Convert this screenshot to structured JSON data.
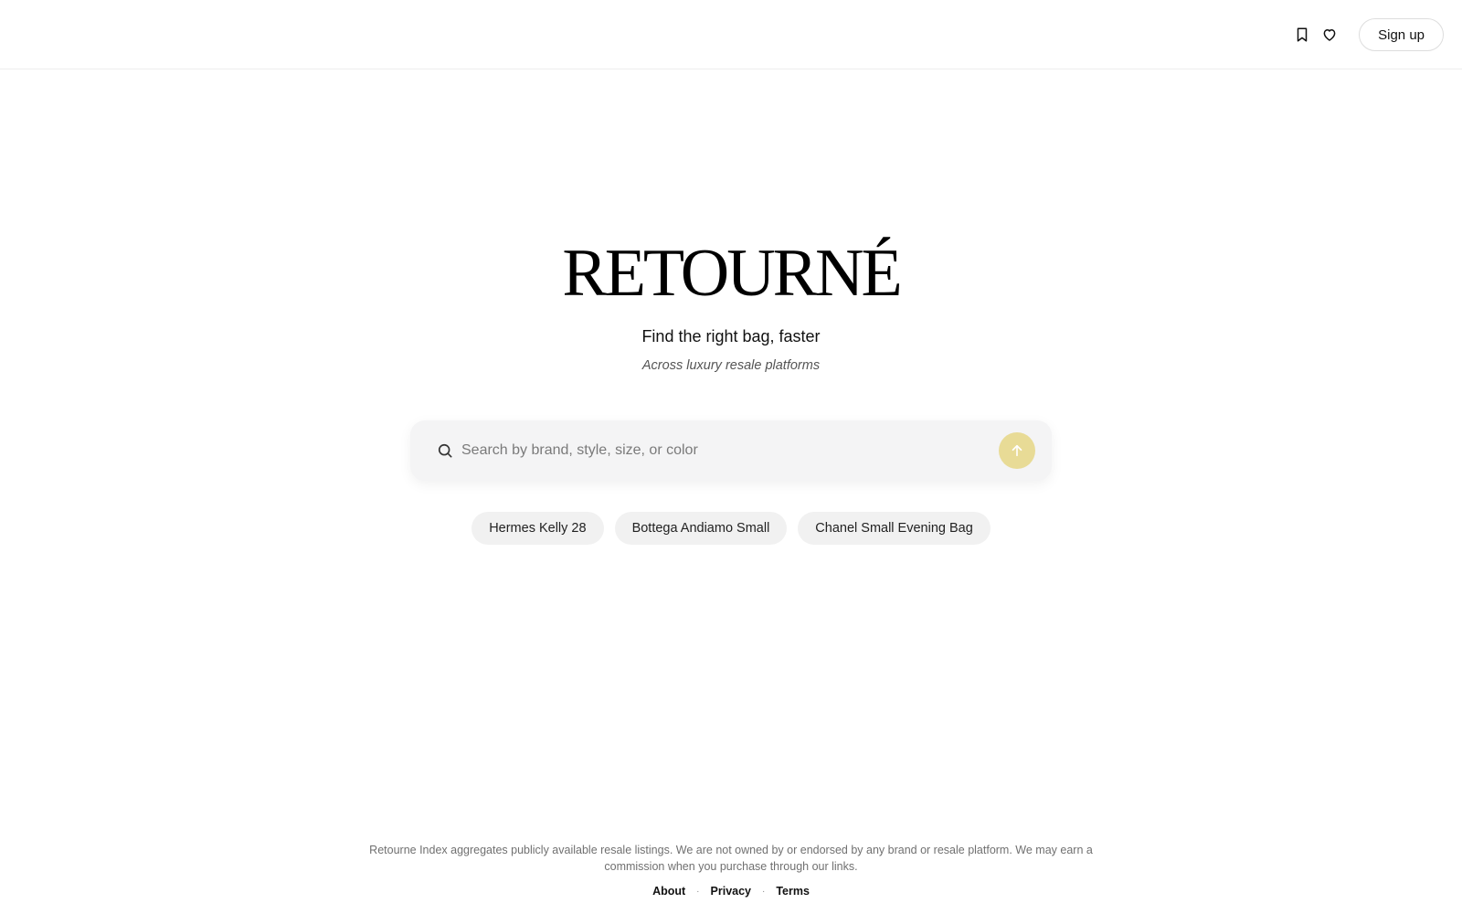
{
  "header": {
    "signup_label": "Sign up",
    "icons": [
      "bookmark-icon",
      "heart-icon"
    ]
  },
  "hero": {
    "logo": "RETOURNÉ",
    "tagline": "Find the right bag, faster",
    "subtagline": "Across luxury resale platforms"
  },
  "search": {
    "placeholder": "Search by brand, style, size, or color",
    "value": "",
    "submit_icon": "arrow-up-icon",
    "accent_color": "#e8db96"
  },
  "suggestions": [
    "Hermes Kelly 28",
    "Bottega Andiamo Small",
    "Chanel Small Evening Bag"
  ],
  "footer": {
    "disclaimer": "Retourne Index aggregates publicly available resale listings. We are not owned by or endorsed by any brand or resale platform. We may earn a commission when you purchase through our links.",
    "links": [
      "About",
      "Privacy",
      "Terms"
    ],
    "separator": "·"
  }
}
